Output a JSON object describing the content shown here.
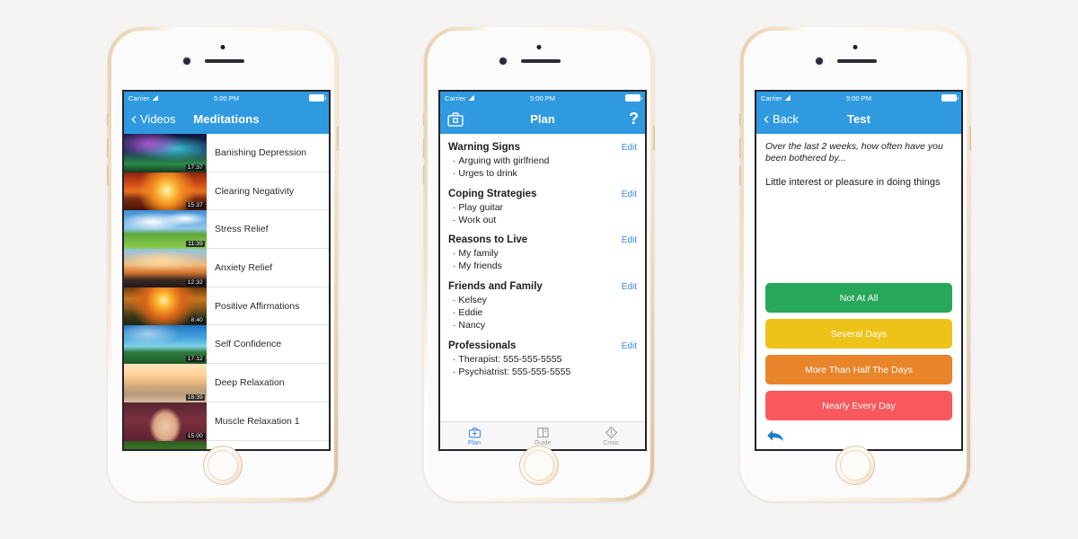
{
  "page": {
    "background_color": "#f5f4f3",
    "device": "iPhone 6 Gold",
    "accent_blue": "#2f9ae0",
    "link_blue": "#3b86e8"
  },
  "status_bar": {
    "carrier": "Carrier",
    "wifi_icon": "wifi-icon",
    "time": "5:00 PM",
    "battery_icon": "battery-full-icon"
  },
  "phone1": {
    "nav": {
      "back_icon": "chevron-left-icon",
      "back_label": "Videos",
      "title": "Meditations"
    },
    "videos": [
      {
        "title": "Banishing Depression",
        "duration": "17:37",
        "thumb": "th-aurora"
      },
      {
        "title": "Clearing Negativity",
        "duration": "15:37",
        "thumb": "th-sunset1"
      },
      {
        "title": "Stress Relief",
        "duration": "11:39",
        "thumb": "th-meadow"
      },
      {
        "title": "Anxiety Relief",
        "duration": "12:32",
        "thumb": "th-islands"
      },
      {
        "title": "Positive Affirmations",
        "duration": "8:40",
        "thumb": "th-lake"
      },
      {
        "title": "Self Confidence",
        "duration": "17:12",
        "thumb": "th-palms"
      },
      {
        "title": "Deep Relaxation",
        "duration": "18:39",
        "thumb": "th-beach"
      },
      {
        "title": "Muscle Relaxation 1",
        "duration": "15:00",
        "thumb": "th-muscle"
      },
      {
        "title": "",
        "duration": "",
        "thumb": "th-forest"
      }
    ]
  },
  "phone2": {
    "nav": {
      "left_icon": "toolbox-icon",
      "title": "Plan",
      "right_label": "?"
    },
    "edit_label": "Edit",
    "sections": [
      {
        "title": "Warning Signs",
        "items": [
          "Arguing with girlfriend",
          "Urges to drink"
        ]
      },
      {
        "title": "Coping Strategies",
        "items": [
          "Play guitar",
          "Work out"
        ]
      },
      {
        "title": "Reasons to Live",
        "items": [
          "My family",
          "My friends"
        ]
      },
      {
        "title": "Friends and Family",
        "items": [
          "Kelsey",
          "Eddie",
          "Nancy"
        ]
      },
      {
        "title": "Professionals",
        "items": [
          "Therapist: 555-555-5555",
          "Psychiatrist: 555-555-5555"
        ]
      }
    ],
    "tabs": [
      {
        "label": "Plan",
        "icon": "toolbox-icon",
        "active": true
      },
      {
        "label": "Guide",
        "icon": "book-icon",
        "active": false
      },
      {
        "label": "Crisis",
        "icon": "warning-diamond-icon",
        "active": false
      }
    ]
  },
  "phone3": {
    "nav": {
      "back_icon": "chevron-left-icon",
      "back_label": "Back",
      "title": "Test"
    },
    "prompt": "Over the last 2 weeks, how often have you been bothered by...",
    "question": "Little interest or pleasure in doing things",
    "answers": [
      {
        "label": "Not At All",
        "color": "#27a85a"
      },
      {
        "label": "Several Days",
        "color": "#edc319"
      },
      {
        "label": "More Than Half The Days",
        "color": "#e8842a"
      },
      {
        "label": "Nearly Every Day",
        "color": "#f9585c"
      }
    ],
    "back_arrow_icon": "back-arrow-icon",
    "back_arrow_color": "#1f7ec4"
  }
}
